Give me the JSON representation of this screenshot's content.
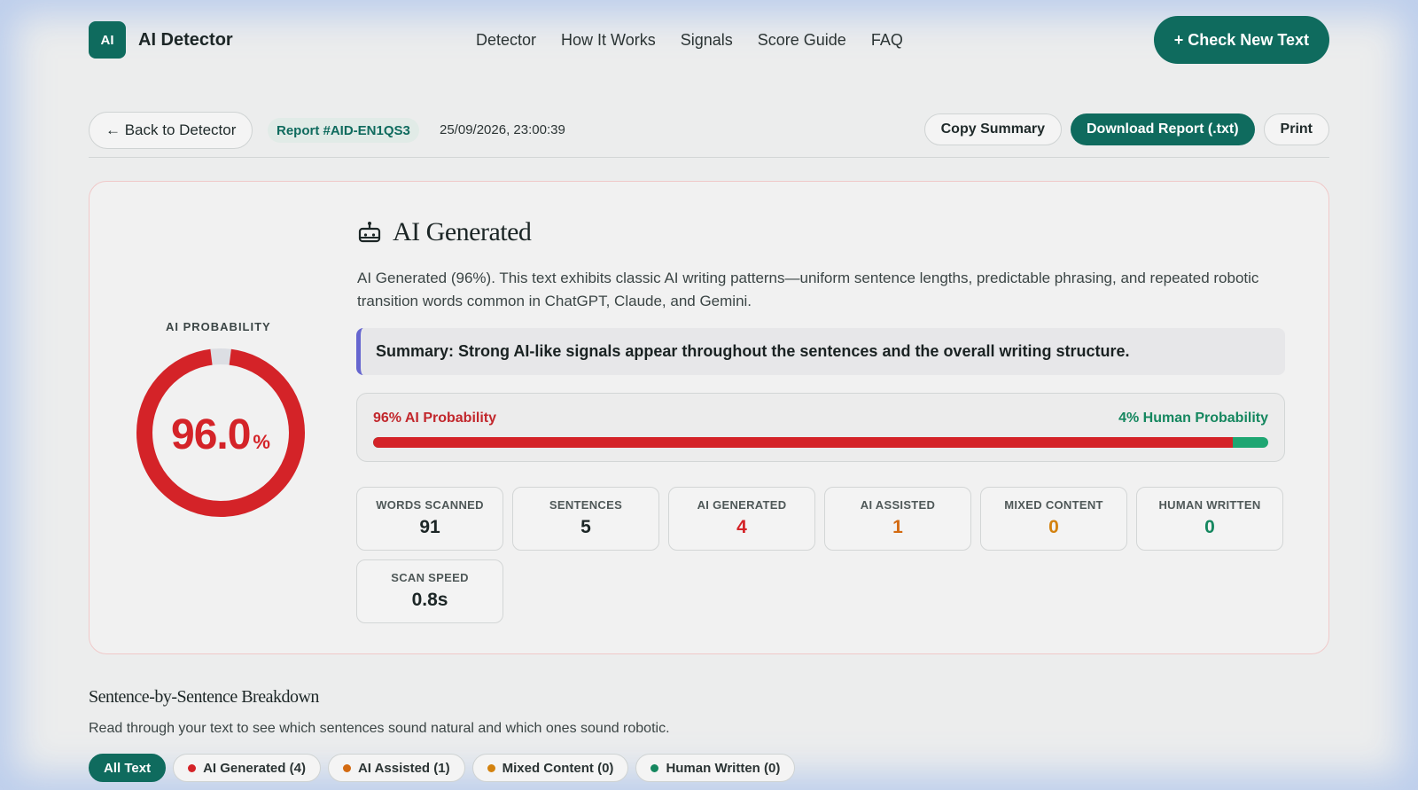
{
  "header": {
    "logo_text": "AI",
    "brand": "AI Detector",
    "nav": [
      "Detector",
      "How It Works",
      "Signals",
      "Score Guide",
      "FAQ"
    ],
    "cta": "+ Check New Text"
  },
  "report": {
    "back_label": "← Back to Detector",
    "id": "Report #AID-EN1QS3",
    "datetime": "25/09/2026, 23:00:39",
    "copy_label": "Copy Summary",
    "download_label": "Download Report (.txt)",
    "print_label": "Print"
  },
  "result": {
    "probability_label": "AI PROBABILITY",
    "probability_value": "96.0",
    "probability_unit": "%",
    "ai_fraction": 0.96,
    "verdict": "AI Generated",
    "description": "AI Generated (96%). This text exhibits classic AI writing patterns—uniform sentence lengths, predictable phrasing, and repeated robotic transition words common in ChatGPT, Claude, and Gemini.",
    "summary": "Summary: Strong AI-like signals appear throughout the sentences and the overall writing structure.",
    "ai_prob_text": "96% AI Probability",
    "human_prob_text": "4% Human Probability",
    "colors": {
      "ai": "#d42328",
      "human": "#1ea672",
      "accent": "#0f6b5e"
    }
  },
  "stats": [
    {
      "label": "WORDS SCANNED",
      "value": "91"
    },
    {
      "label": "SENTENCES",
      "value": "5"
    },
    {
      "label": "AI GENERATED",
      "value": "4"
    },
    {
      "label": "AI ASSISTED",
      "value": "1"
    },
    {
      "label": "MIXED CONTENT",
      "value": "0"
    },
    {
      "label": "HUMAN WRITTEN",
      "value": "0"
    },
    {
      "label": "SCAN SPEED",
      "value": "0.8s"
    }
  ],
  "breakdown": {
    "title": "Sentence-by-Sentence Breakdown",
    "subtitle": "Read through your text to see which sentences sound natural and which ones sound robotic.",
    "filters": [
      "All Text",
      "AI Generated (4)",
      "AI Assisted (1)",
      "Mixed Content (0)",
      "Human Written (0)"
    ]
  },
  "icons": {
    "verdict": "robot-icon",
    "back": "arrow-left-icon"
  }
}
